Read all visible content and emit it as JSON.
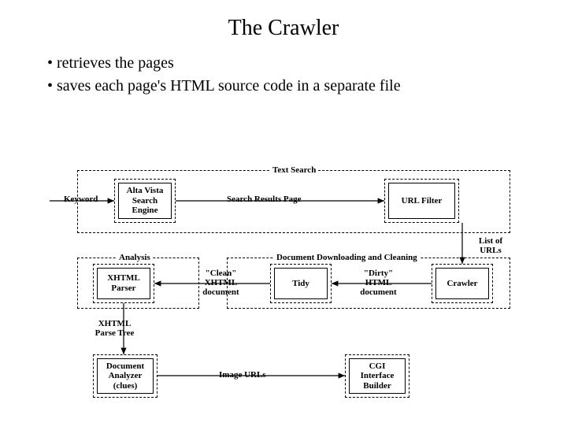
{
  "title": "The Crawler",
  "bullets": [
    "retrieves the pages",
    "saves each page's HTML source code in a separate file"
  ],
  "sections": {
    "text_search": "Text Search",
    "analysis": "Analysis",
    "download_clean": "Document Downloading and Cleaning"
  },
  "boxes": {
    "alta_vista": "Alta Vista Search Engine",
    "url_filter": "URL Filter",
    "xhtml_parser": "XHTML Parser",
    "tidy": "Tidy",
    "crawler": "Crawler",
    "doc_analyzer": "Document Analyzer (clues)",
    "cgi_builder": "CGI Interface Builder"
  },
  "edges": {
    "keyword": "Keyword",
    "search_results": "Search Results Page",
    "list_urls": "List of URLs",
    "clean_doc": "\"Clean\" XHTML document",
    "dirty_doc": "\"Dirty\" HTML document",
    "parse_tree": "XHTML Parse Tree",
    "image_urls": "Image URLs"
  }
}
